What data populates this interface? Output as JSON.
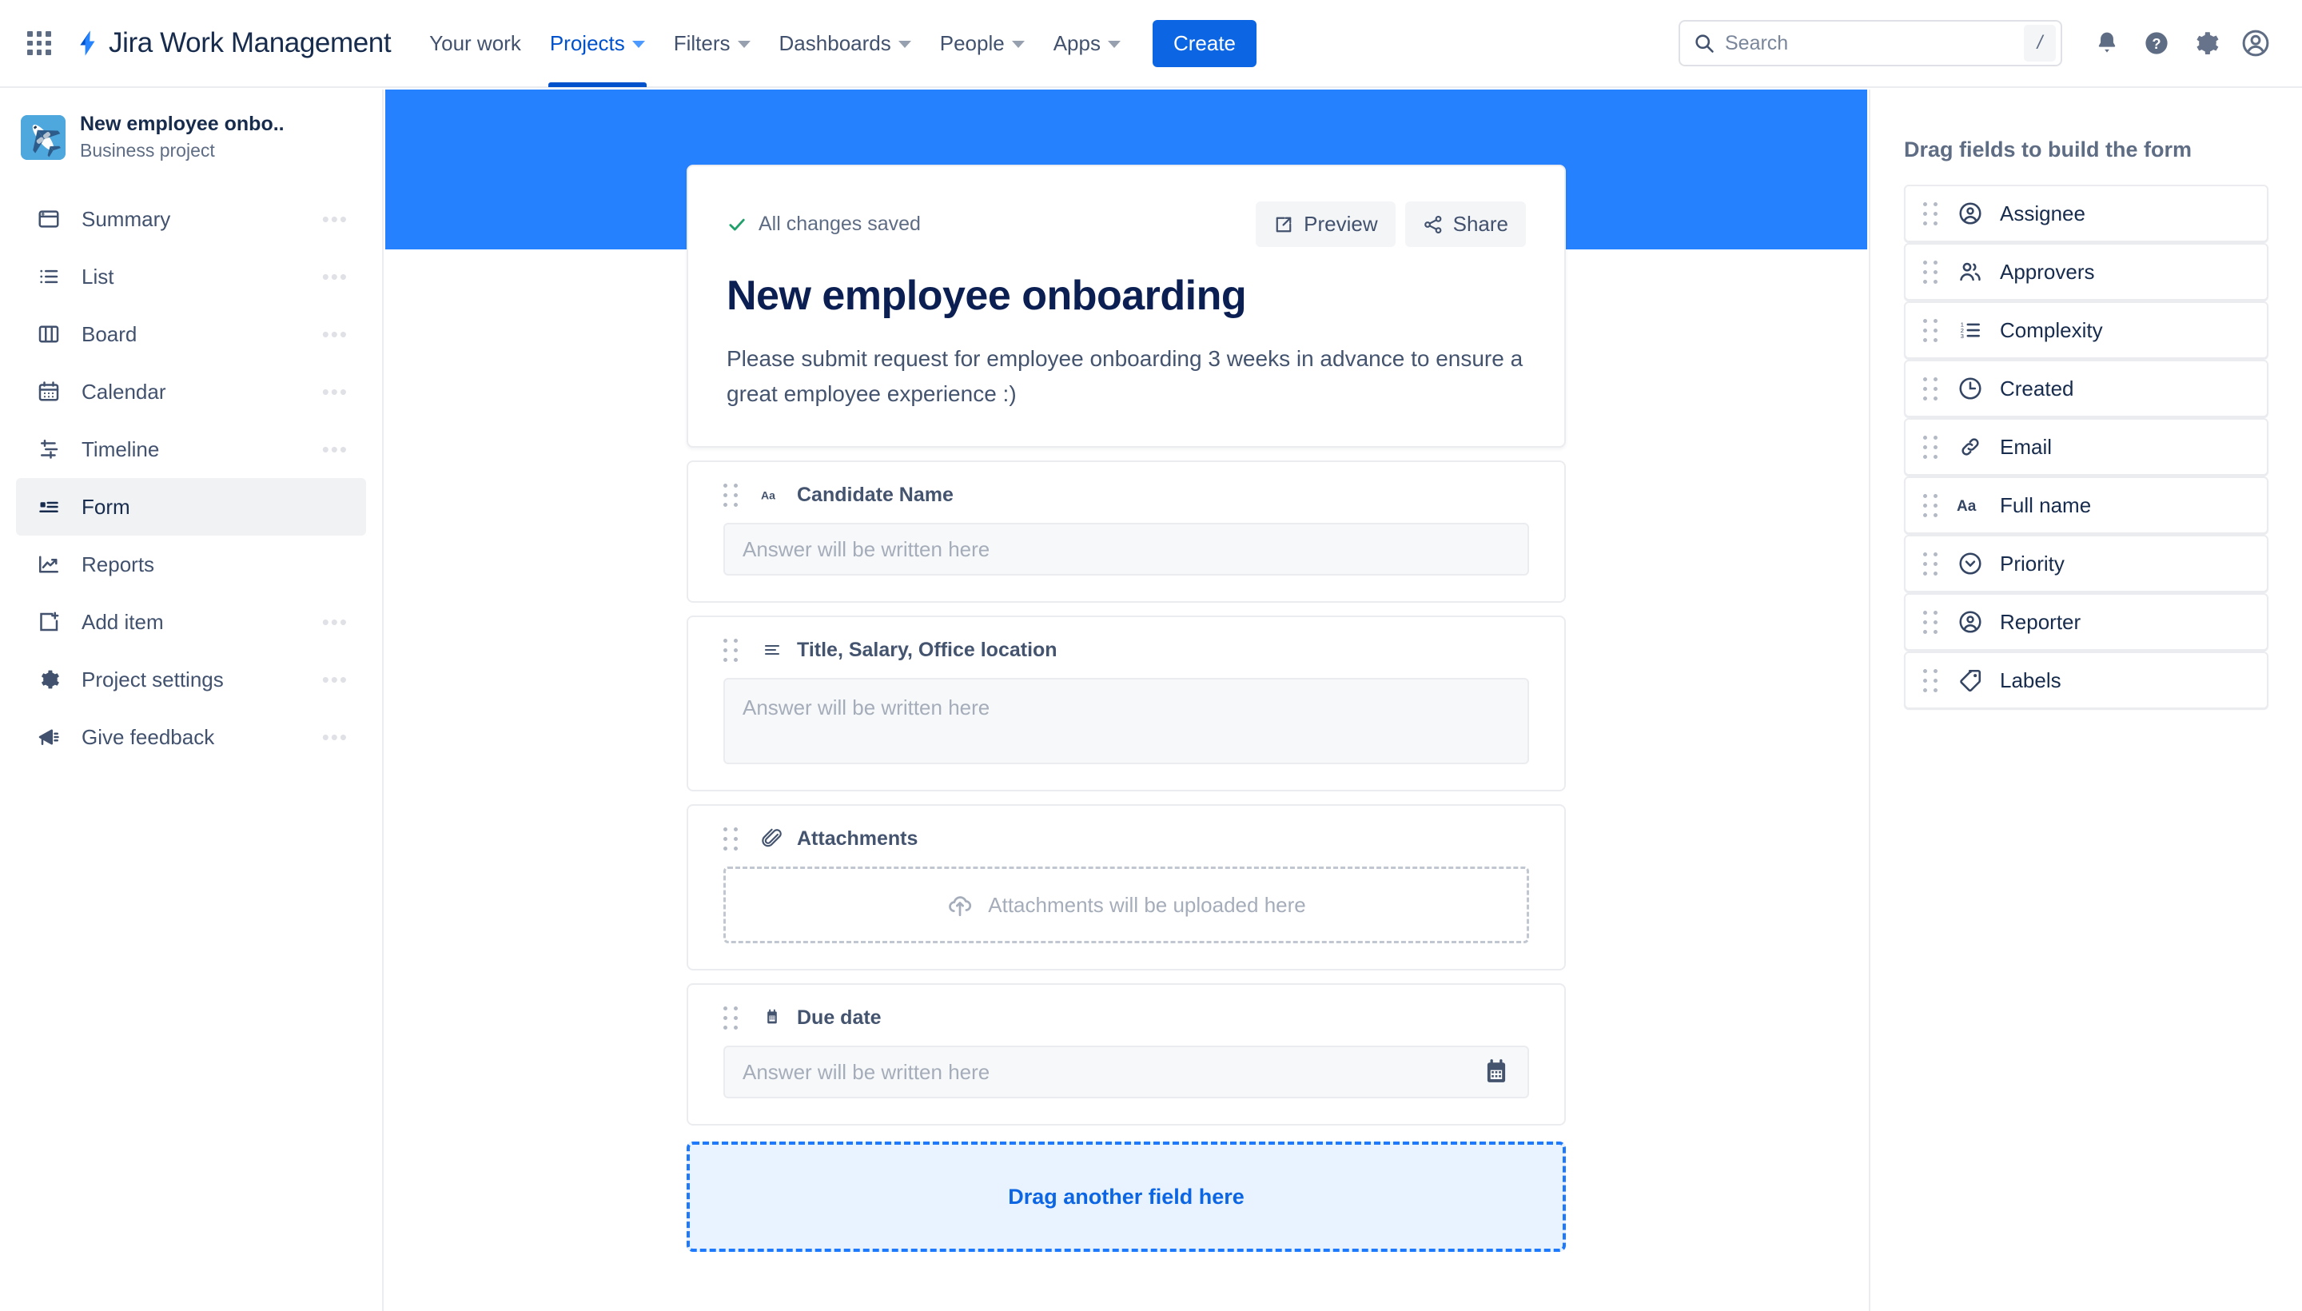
{
  "topnav": {
    "app_switcher_icon": "grid-apps-icon",
    "brand_logo_icon": "jira-logo-icon",
    "brand": "Jira Work Management",
    "links": [
      {
        "label": "Your work",
        "has_caret": false,
        "active": false
      },
      {
        "label": "Projects",
        "has_caret": true,
        "active": true
      },
      {
        "label": "Filters",
        "has_caret": true,
        "active": false
      },
      {
        "label": "Dashboards",
        "has_caret": true,
        "active": false
      },
      {
        "label": "People",
        "has_caret": true,
        "active": false
      },
      {
        "label": "Apps",
        "has_caret": true,
        "active": false
      }
    ],
    "create_label": "Create",
    "search": {
      "placeholder": "Search",
      "value": "",
      "shortcut": "/",
      "icon": "search-icon"
    },
    "icons": [
      "notifications-bell-icon",
      "help-question-icon",
      "settings-gear-icon",
      "user-avatar-icon"
    ]
  },
  "sidebar": {
    "project": {
      "avatar_icon": "airplane-project-avatar",
      "name": "New employee onbo..",
      "type": "Business project"
    },
    "items": [
      {
        "label": "Summary",
        "icon": "summary-icon",
        "selected": false,
        "more": "•••"
      },
      {
        "label": "List",
        "icon": "list-icon",
        "selected": false,
        "more": "•••"
      },
      {
        "label": "Board",
        "icon": "board-icon",
        "selected": false,
        "more": "•••"
      },
      {
        "label": "Calendar",
        "icon": "calendar-icon",
        "selected": false,
        "more": "•••"
      },
      {
        "label": "Timeline",
        "icon": "timeline-icon",
        "selected": false,
        "more": "•••"
      },
      {
        "label": "Form",
        "icon": "form-icon",
        "selected": true,
        "more": ""
      },
      {
        "label": "Reports",
        "icon": "reports-icon",
        "selected": false,
        "more": ""
      },
      {
        "label": "Add item",
        "icon": "add-item-icon",
        "selected": false,
        "more": "•••"
      },
      {
        "label": "Project settings",
        "icon": "project-settings-gear-icon",
        "selected": false,
        "more": "•••"
      },
      {
        "label": "Give feedback",
        "icon": "megaphone-icon",
        "selected": false,
        "more": "•••"
      }
    ]
  },
  "form": {
    "saved_status": "All changes saved",
    "saved_icon": "check-icon",
    "preview_label": "Preview",
    "preview_icon": "external-link-icon",
    "share_label": "Share",
    "share_icon": "share-icon",
    "title": "New employee onboarding",
    "description": "Please submit request for employee onboarding 3 weeks in advance to ensure a great employee experience :)",
    "fields": [
      {
        "label": "Candidate Name",
        "icon": "text-short-aa-icon",
        "kind": "short-text",
        "placeholder": "Answer will be written here"
      },
      {
        "label": "Title, Salary, Office location",
        "icon": "paragraph-lines-icon",
        "kind": "long-text",
        "placeholder": "Answer will be written here"
      },
      {
        "label": "Attachments",
        "icon": "paperclip-icon",
        "kind": "attachment",
        "placeholder": "Attachments will be uploaded here",
        "upload_icon": "cloud-upload-icon"
      },
      {
        "label": "Due date",
        "icon": "due-date-calendar-icon",
        "kind": "date",
        "placeholder": "Answer will be written here",
        "trailing_icon": "calendar-picker-icon"
      }
    ],
    "dropzone_label": "Drag another field here"
  },
  "right_panel": {
    "title": "Drag fields to build the form",
    "fields": [
      {
        "label": "Assignee",
        "icon": "person-circle-icon"
      },
      {
        "label": "Approvers",
        "icon": "people-group-icon"
      },
      {
        "label": "Complexity",
        "icon": "numbered-list-icon"
      },
      {
        "label": "Created",
        "icon": "clock-icon"
      },
      {
        "label": "Email",
        "icon": "link-chain-icon"
      },
      {
        "label": "Full name",
        "icon": "text-aa-icon"
      },
      {
        "label": "Priority",
        "icon": "priority-chevron-circle-icon"
      },
      {
        "label": "Reporter",
        "icon": "person-circle-icon"
      },
      {
        "label": "Labels",
        "icon": "tag-label-icon"
      }
    ]
  },
  "colors": {
    "brand_blue": "#0052cc",
    "create_blue": "#0c66e4",
    "banner_blue": "#2681ff",
    "dropzone_border": "#1d7afc",
    "dropzone_bg": "#e9f2ff",
    "text_dark": "#172b4d",
    "text_muted": "#5e6c84",
    "saved_green": "#22a06b"
  }
}
